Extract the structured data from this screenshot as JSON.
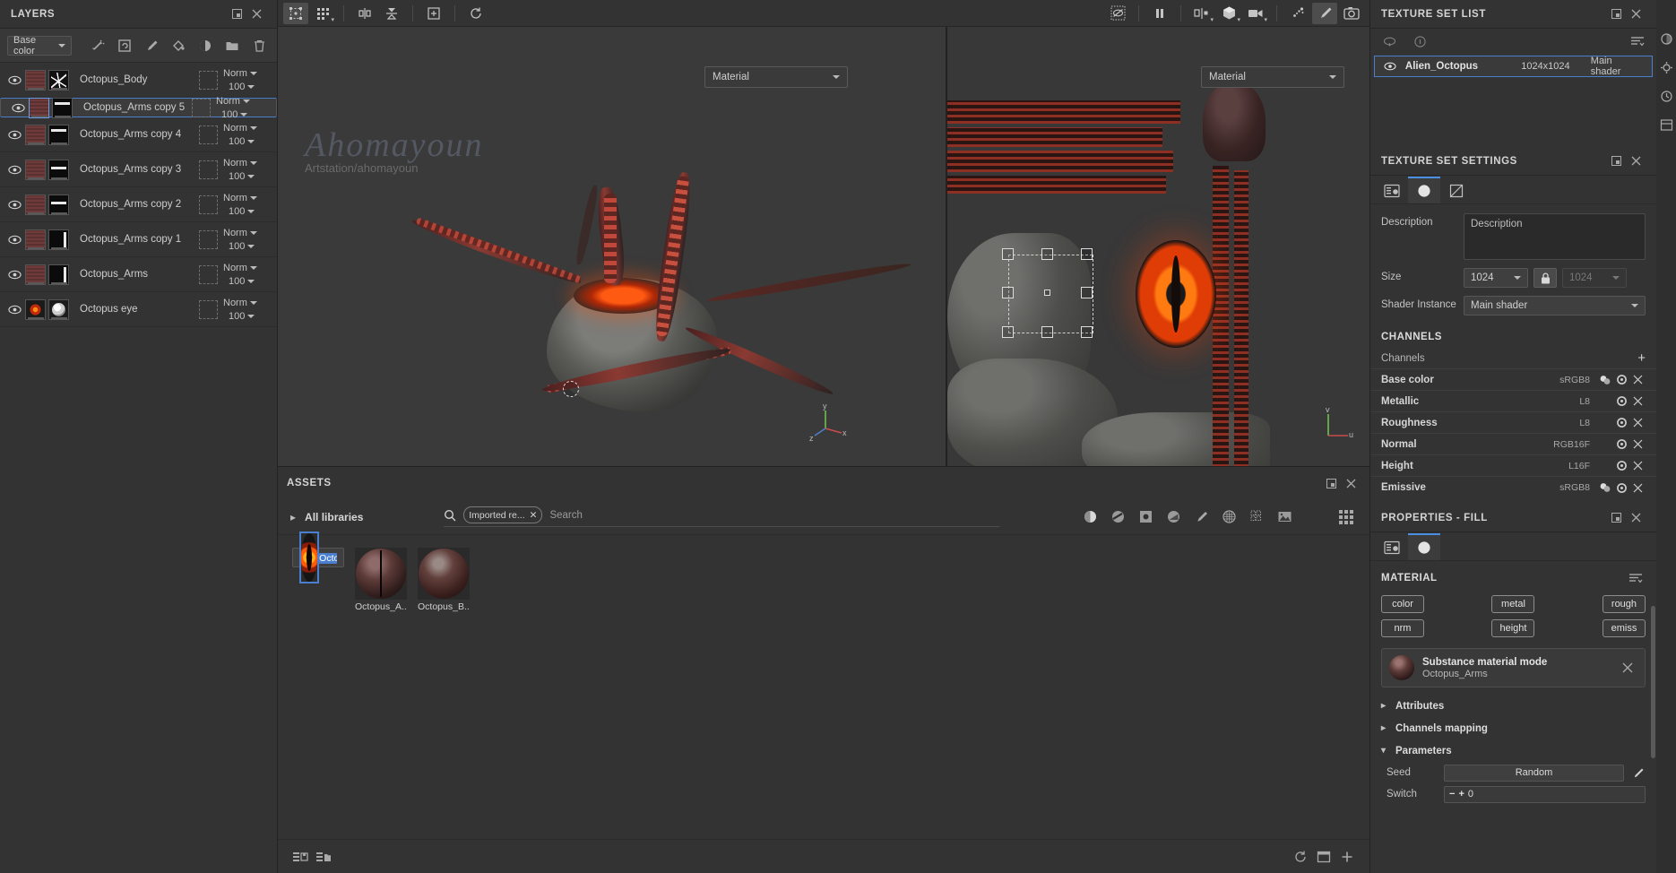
{
  "layers_panel": {
    "title": "LAYERS",
    "channel_select": "Base color",
    "toolbar_icons": [
      "magic-wand-icon",
      "rotate-refresh-icon",
      "brush-icon",
      "paint-bucket-icon",
      "sphere-material-icon",
      "folder-icon",
      "trash-icon"
    ],
    "rows": [
      {
        "name": "Octopus_Body",
        "blend": "Norm",
        "opacity": "100",
        "selected": false,
        "thumb": "body"
      },
      {
        "name": "Octopus_Arms copy 5",
        "blend": "Norm",
        "opacity": "100",
        "selected": true,
        "thumb": "arm-b1"
      },
      {
        "name": "Octopus_Arms copy 4",
        "blend": "Norm",
        "opacity": "100",
        "selected": false,
        "thumb": "arm-b1"
      },
      {
        "name": "Octopus_Arms copy 3",
        "blend": "Norm",
        "opacity": "100",
        "selected": false,
        "thumb": "arm-b2"
      },
      {
        "name": "Octopus_Arms copy 2",
        "blend": "Norm",
        "opacity": "100",
        "selected": false,
        "thumb": "arm-b2"
      },
      {
        "name": "Octopus_Arms copy 1",
        "blend": "Norm",
        "opacity": "100",
        "selected": false,
        "thumb": "arm-b3"
      },
      {
        "name": "Octopus_Arms",
        "blend": "Norm",
        "opacity": "100",
        "selected": false,
        "thumb": "arm-b3"
      },
      {
        "name": "Octopus eye",
        "blend": "Norm",
        "opacity": "100",
        "selected": false,
        "thumb": "eye"
      }
    ]
  },
  "top_toolbar": {
    "left_icons": [
      "selection-box-icon",
      "grid-dots-icon",
      "mirror-icon",
      "symmetry-icon",
      "add-frame-icon",
      "history-undo-icon"
    ],
    "right_icons": [
      "hide-display-icon",
      "pause-icon",
      "split-view-icon",
      "cube-3d-icon",
      "camera-view-icon",
      "particles-icon",
      "brush-icon",
      "screenshot-icon"
    ]
  },
  "viewport": {
    "material_dropdown_3d": "Material",
    "material_dropdown_2d": "Material",
    "watermark_signature": "Ahomayoun",
    "watermark_url": "Artstation/ahomayoun",
    "axis_3d": {
      "x": "x",
      "y": "y",
      "z": "z"
    },
    "axis_2d": {
      "u": "u",
      "v": "v"
    }
  },
  "assets_panel": {
    "title": "ASSETS",
    "library_label": "All libraries",
    "search_chip": "Imported re...",
    "search_placeholder": "Search",
    "filter_icons": [
      "material-sphere-icon",
      "smart-material-icon",
      "alpha-square-icon",
      "smart-mask-icon",
      "brush-icon",
      "procedural-grid-icon",
      "grid-pattern-icon",
      "texture-image-icon"
    ],
    "view_toggle_icon": "grid-view-icon",
    "items": [
      {
        "label": "Octopus eye",
        "selected": true,
        "art": "eye"
      },
      {
        "label": "Octopus_A...",
        "selected": false,
        "art": "sphere-a"
      },
      {
        "label": "Octopus_B...",
        "selected": false,
        "art": "sphere-b"
      }
    ],
    "footer_icons": [
      "list-add-icon",
      "folder-add-icon"
    ],
    "footer_right_icons": [
      "refresh-icon",
      "new-window-icon",
      "plus-icon"
    ]
  },
  "texture_set_list": {
    "title": "TEXTURE SET LIST",
    "tool_icons": [
      "hide-all-icon",
      "info-icon",
      "settings-list-icon"
    ],
    "row": {
      "name": "Alien_Octopus",
      "resolution": "1024x1024",
      "shader": "Main shader"
    }
  },
  "texture_set_settings": {
    "title": "TEXTURE SET SETTINGS",
    "tabs": [
      "settings-sliders-icon",
      "material-sphere-icon",
      "uv-mesh-icon"
    ],
    "active_tab": 1,
    "description_label": "Description",
    "description_value": "Description",
    "size_label": "Size",
    "size_value": "1024",
    "size_value_locked": "1024",
    "lock_icon": "lock-closed-icon",
    "shader_instance_label": "Shader Instance",
    "shader_instance_value": "Main shader",
    "channels_header": "CHANNELS",
    "channels_row_label": "Channels",
    "channels": [
      {
        "name": "Base color",
        "format": "sRGB8",
        "has_color_icon": true
      },
      {
        "name": "Metallic",
        "format": "L8",
        "has_color_icon": false
      },
      {
        "name": "Roughness",
        "format": "L8",
        "has_color_icon": false
      },
      {
        "name": "Normal",
        "format": "RGB16F",
        "has_color_icon": false
      },
      {
        "name": "Height",
        "format": "L16F",
        "has_color_icon": false
      },
      {
        "name": "Emissive",
        "format": "sRGB8",
        "has_color_icon": true
      }
    ]
  },
  "properties_fill": {
    "title": "PROPERTIES - FILL",
    "tabs": [
      "settings-sliders-icon",
      "material-sphere-icon"
    ],
    "active_tab": 1,
    "material_header": "MATERIAL",
    "material_menu_icon": "list-menu-icon",
    "channel_chips": [
      "color",
      "metal",
      "rough",
      "nrm",
      "height",
      "emiss"
    ],
    "material_card": {
      "title": "Substance material mode",
      "subtitle": "Octopus_Arms",
      "close_icon": "close-icon"
    },
    "sections": [
      {
        "label": "Attributes",
        "expanded": false
      },
      {
        "label": "Channels mapping",
        "expanded": false
      },
      {
        "label": "Parameters",
        "expanded": true
      }
    ],
    "parameters": [
      {
        "label": "Seed",
        "value": "Random",
        "type": "button"
      },
      {
        "label": "Switch",
        "value": "0",
        "type": "number"
      }
    ]
  },
  "right_rail_icons": [
    "layers-rail-icon",
    "display-rail-icon",
    "history-rail-icon",
    "shelf-rail-icon"
  ],
  "colors": {
    "accent": "#4a7fd0",
    "panel": "#333333",
    "toolbar": "#383838",
    "emissive": "#ff5a0a"
  }
}
